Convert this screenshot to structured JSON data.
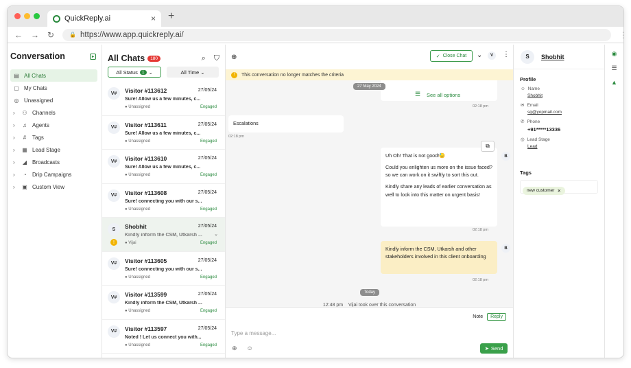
{
  "browser": {
    "tab_title": "QuickReply.ai",
    "tab_close": "×",
    "new_tab": "+",
    "url": "https://www.app.quickreply.ai/",
    "colors": {
      "red": "#ff5f57",
      "yellow": "#febc2e",
      "green": "#28c840"
    }
  },
  "sidebar": {
    "title": "Conversation",
    "items": [
      {
        "label": "All Chats",
        "icon": "chat-icon"
      },
      {
        "label": "My Chats",
        "icon": "chat-icon"
      },
      {
        "label": "Unassigned",
        "icon": "unassigned-icon"
      },
      {
        "label": "Channels",
        "icon": "channels-icon"
      },
      {
        "label": "Agents",
        "icon": "headset-icon"
      },
      {
        "label": "Tags",
        "icon": "tag-icon"
      },
      {
        "label": "Lead Stage",
        "icon": "chart-icon"
      },
      {
        "label": "Broadcasts",
        "icon": "megaphone-icon"
      },
      {
        "label": "Drip Campaigns",
        "icon": "drip-icon"
      },
      {
        "label": "Custom View",
        "icon": "view-icon"
      }
    ]
  },
  "chats": {
    "title": "All Chats",
    "count": "180",
    "filter_status": "All Status",
    "filter_status_count": "1",
    "filter_time": "All Time",
    "rows": [
      {
        "avatar": "V#",
        "name": "Visitor #113612",
        "date": "27/05/24",
        "msg": "Sure! Allow us a few minutes, c...",
        "agent": "Unassigned",
        "status": "Engaged"
      },
      {
        "avatar": "V#",
        "name": "Visitor #113611",
        "date": "27/05/24",
        "msg": "Sure! Allow us a few minutes, c...",
        "agent": "Unassigned",
        "status": "Engaged"
      },
      {
        "avatar": "V#",
        "name": "Visitor #113610",
        "date": "27/05/24",
        "msg": "Sure! Allow us a few minutes, c...",
        "agent": "Unassigned",
        "status": "Engaged"
      },
      {
        "avatar": "V#",
        "name": "Visitor #113608",
        "date": "27/05/24",
        "msg": "Sure! connecting you with our s...",
        "agent": "Unassigned",
        "status": "Engaged"
      },
      {
        "avatar": "S",
        "name": "Shobhit",
        "date": "27/05/24",
        "msg": "Kindly inform the CSM, Utkarsh ...",
        "agent": "Vijai",
        "status": "Engaged"
      },
      {
        "avatar": "V#",
        "name": "Visitor #113605",
        "date": "27/05/24",
        "msg": "Sure! connecting you with our s...",
        "agent": "Unassigned",
        "status": "Engaged"
      },
      {
        "avatar": "V#",
        "name": "Visitor #113599",
        "date": "27/05/24",
        "msg": "Kindly inform the CSM, Utkarsh ...",
        "agent": "Unassigned",
        "status": "Engaged"
      },
      {
        "avatar": "V#",
        "name": "Visitor #113597",
        "date": "27/05/24",
        "msg": "Noted ! Let us connect you with...",
        "agent": "Unassigned",
        "status": "Engaged"
      }
    ]
  },
  "conversation": {
    "close_chat": "Close Chat",
    "agent_avatar": "V",
    "banner": "This conversation no longer matches the criteria",
    "date_pill": "27 May 2024",
    "see_all": "See all options",
    "time1": "02:18 pm",
    "escalations": "Escalations",
    "time2": "02:18 pm",
    "msg1_p1": "Uh Oh! That is not good!😓",
    "msg1_p2": "Could you enlighten us more on the issue faced? so we can work on it swiftly to sort this out.",
    "msg1_p3": "Kindly share any leads of earlier conversation as well to look into this matter on urgent basis!",
    "time3": "02:18 pm",
    "msg2": "Kindly inform the CSM, Utkarsh and other stakeholders involved in this client onboarding",
    "time4": "02:18 pm",
    "bot_avatar": "B",
    "today": "Today",
    "sys_time": "12:48 pm",
    "sys_msg": "Vijai took over this conversation",
    "note": "Note",
    "reply": "Reply",
    "placeholder": "Type a message...",
    "send": "Send"
  },
  "profile": {
    "avatar": "S",
    "name": "Shobhit",
    "section": "Profile",
    "name_label": "Name",
    "name_value": "Shobhit",
    "email_label": "Email",
    "email_value": "sg@yopmail.com",
    "phone_label": "Phone",
    "phone_value": "+91*****13336",
    "lead_label": "Lead Stage",
    "lead_value": "Lead",
    "tags_label": "Tags",
    "tag": "new customer"
  }
}
